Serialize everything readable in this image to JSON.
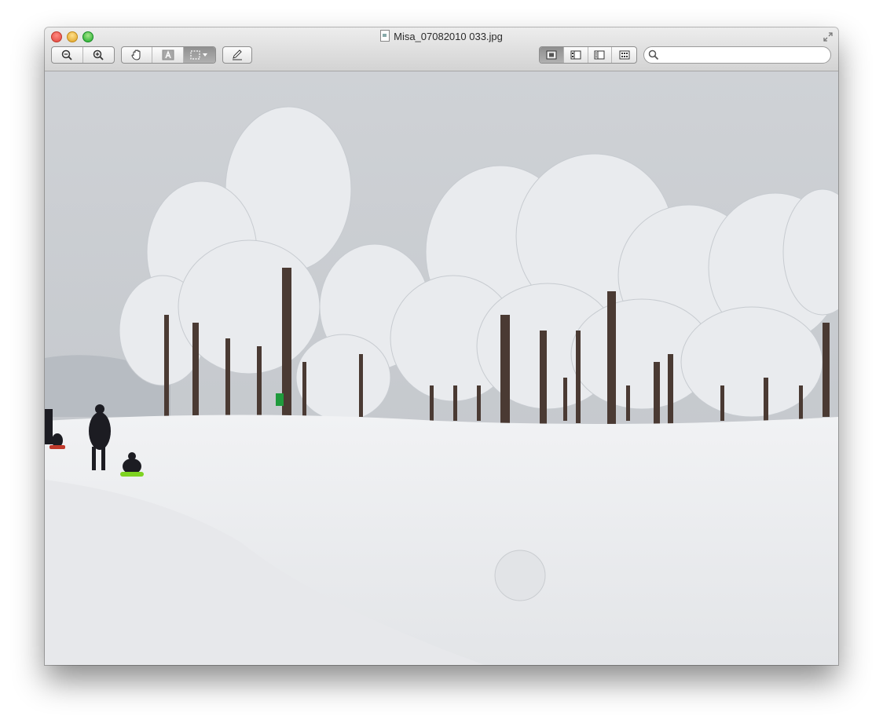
{
  "window": {
    "title": "Misa_07082010 033.jpg"
  },
  "toolbar": {
    "zoom_group": [
      "zoom-out-icon",
      "zoom-in-icon"
    ],
    "tools_group": [
      "hand-icon",
      "text-select-icon",
      "rect-select-icon"
    ],
    "annotate": "pencil-icon",
    "view_modes": [
      "content-only-icon",
      "thumbnails-icon",
      "table-of-contents-icon",
      "contact-sheet-icon"
    ],
    "active_view_mode": "content-only",
    "search_placeholder": ""
  },
  "image": {
    "description_colors": {
      "sky": "#c9ccd0",
      "snow": "#eef0f2",
      "trunk": "#4a3a33"
    }
  }
}
